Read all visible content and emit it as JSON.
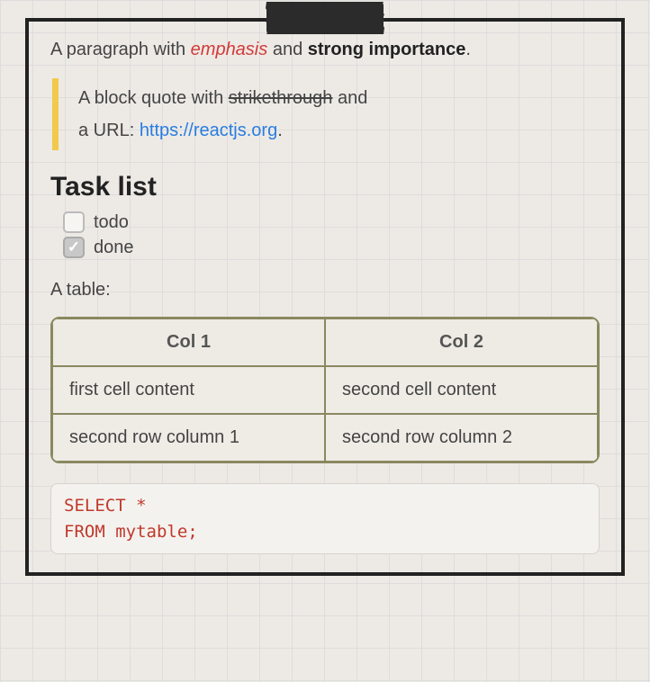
{
  "paragraph": {
    "prefix": "A paragraph with ",
    "emphasis": "emphasis",
    "mid": " and ",
    "strong": "strong importance",
    "suffix": "."
  },
  "blockquote": {
    "line1_prefix": "A block quote with ",
    "strike": "strikethrough",
    "line1_suffix": " and",
    "line2_prefix": "a URL: ",
    "url_text": "https://reactjs.org",
    "url_href": "https://reactjs.org",
    "line2_suffix": "."
  },
  "heading": "Task list",
  "tasks": {
    "item1": {
      "label": "todo",
      "checked": false
    },
    "item2": {
      "label": "done",
      "checked": true
    }
  },
  "table_label": "A table:",
  "table": {
    "headers": {
      "col1": "Col 1",
      "col2": "Col 2"
    },
    "rows": {
      "r1": {
        "c1": "first cell content",
        "c2": "second cell content"
      },
      "r2": {
        "c1": "second row column 1",
        "c2": "second row column 2"
      }
    }
  },
  "code": "SELECT *\nFROM mytable;"
}
